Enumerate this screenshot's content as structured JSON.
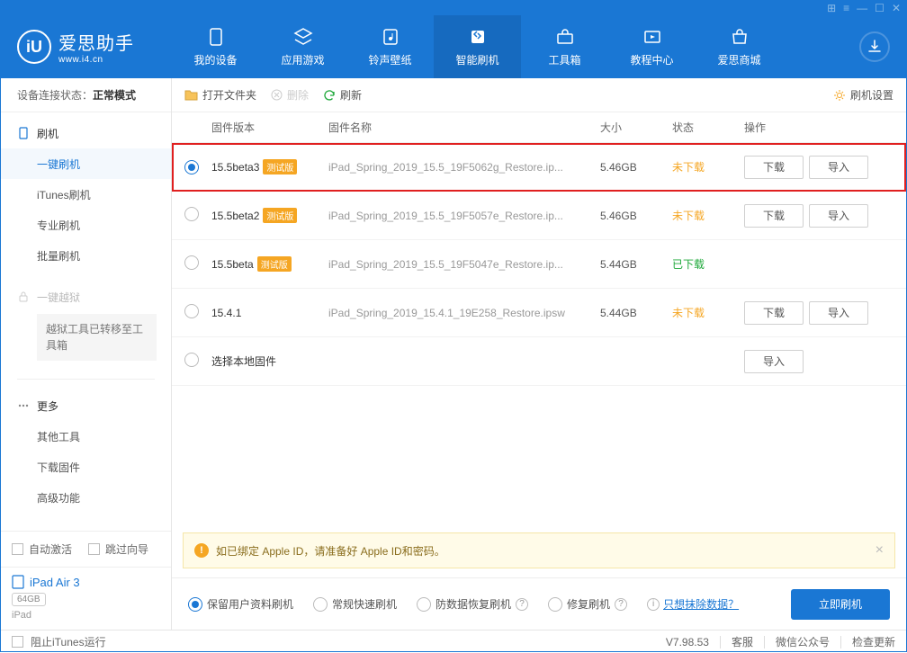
{
  "titlebar_icons": [
    "grid-icon",
    "list-icon",
    "minimize-icon",
    "maximize-icon",
    "close-icon"
  ],
  "logo": {
    "icon": "iU",
    "title": "爱思助手",
    "sub": "www.i4.cn"
  },
  "nav": [
    {
      "label": "我的设备",
      "icon": "device"
    },
    {
      "label": "应用游戏",
      "icon": "apps"
    },
    {
      "label": "铃声壁纸",
      "icon": "music"
    },
    {
      "label": "智能刷机",
      "icon": "flash",
      "active": true
    },
    {
      "label": "工具箱",
      "icon": "toolbox"
    },
    {
      "label": "教程中心",
      "icon": "tutorial"
    },
    {
      "label": "爱思商城",
      "icon": "store"
    }
  ],
  "sidebar": {
    "conn_label": "设备连接状态：",
    "conn_value": "正常模式",
    "flash_head": "刷机",
    "flash_items": [
      "一键刷机",
      "iTunes刷机",
      "专业刷机",
      "批量刷机"
    ],
    "jailbreak_head": "一键越狱",
    "jailbreak_note": "越狱工具已转移至工具箱",
    "more_head": "更多",
    "more_items": [
      "其他工具",
      "下载固件",
      "高级功能"
    ],
    "auto_activate": "自动激活",
    "skip_guide": "跳过向导",
    "device_name": "iPad Air 3",
    "device_storage": "64GB",
    "device_type": "iPad"
  },
  "toolbar": {
    "open": "打开文件夹",
    "delete": "删除",
    "refresh": "刷新",
    "settings": "刷机设置"
  },
  "columns": {
    "version": "固件版本",
    "name": "固件名称",
    "size": "大小",
    "status": "状态",
    "ops": "操作"
  },
  "beta_tag": "测试版",
  "firmwares": [
    {
      "selected": true,
      "version": "15.5beta3",
      "beta": true,
      "name": "iPad_Spring_2019_15.5_19F5062g_Restore.ip...",
      "size": "5.46GB",
      "status": "未下载",
      "status_cls": "not",
      "download": true,
      "import": true,
      "highlight": true
    },
    {
      "selected": false,
      "version": "15.5beta2",
      "beta": true,
      "name": "iPad_Spring_2019_15.5_19F5057e_Restore.ip...",
      "size": "5.46GB",
      "status": "未下载",
      "status_cls": "not",
      "download": true,
      "import": true
    },
    {
      "selected": false,
      "version": "15.5beta",
      "beta": true,
      "name": "iPad_Spring_2019_15.5_19F5047e_Restore.ip...",
      "size": "5.44GB",
      "status": "已下载",
      "status_cls": "done",
      "download": false,
      "import": false
    },
    {
      "selected": false,
      "version": "15.4.1",
      "beta": false,
      "name": "iPad_Spring_2019_15.4.1_19E258_Restore.ipsw",
      "size": "5.44GB",
      "status": "未下载",
      "status_cls": "not",
      "download": true,
      "import": true
    },
    {
      "selected": false,
      "version": "",
      "beta": false,
      "name": "选择本地固件",
      "local": true,
      "size": "",
      "status": "",
      "download": false,
      "import": true
    }
  ],
  "btn": {
    "download": "下载",
    "import": "导入"
  },
  "notice": "如已绑定 Apple ID，请准备好 Apple ID和密码。",
  "modes": [
    {
      "label": "保留用户资料刷机",
      "checked": true
    },
    {
      "label": "常规快速刷机"
    },
    {
      "label": "防数据恢复刷机",
      "help": true
    },
    {
      "label": "修复刷机",
      "help": true
    }
  ],
  "erase_link": "只想抹除数据？",
  "flash_now": "立即刷机",
  "footer": {
    "block_itunes": "阻止iTunes运行",
    "version": "V7.98.53",
    "support": "客服",
    "wechat": "微信公众号",
    "update": "检查更新"
  }
}
